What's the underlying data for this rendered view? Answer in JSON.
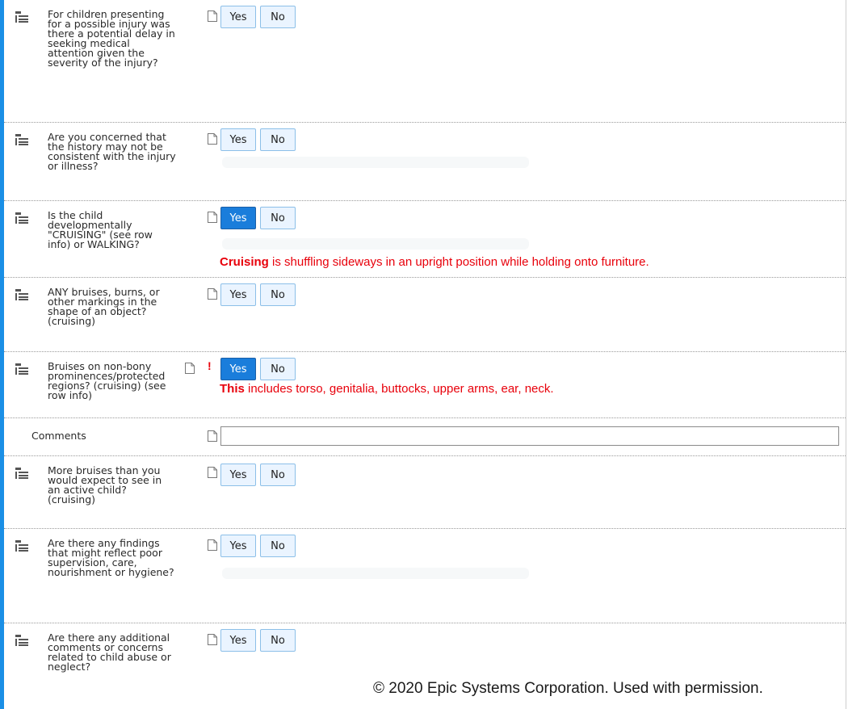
{
  "questions": [
    {
      "text": "For children presenting for a possible injury was there a potential delay in seeking medical attention given the severity of the injury?",
      "selected": null
    },
    {
      "text": "Are you concerned that the history may not be consistent with the injury or illness?",
      "selected": null
    },
    {
      "text": "Is the child developmentally \"CRUISING\" (see row info) or WALKING?",
      "selected": "Yes"
    },
    {
      "text": "ANY bruises, burns, or other markings in the shape of an object? (cruising)",
      "selected": null
    },
    {
      "text": "Bruises on non-bony prominences/protected regions? (cruising) (see row info)",
      "selected": "Yes"
    },
    {
      "text": "More bruises than you would expect to see in an active child? (cruising)",
      "selected": null
    },
    {
      "text": "Are there any findings that might reflect poor supervision, care, nourishment or hygiene?",
      "selected": null
    },
    {
      "text": "Are there any additional comments or concerns related to child abuse or neglect?",
      "selected": null
    }
  ],
  "buttons": {
    "yes": "Yes",
    "no": "No"
  },
  "annotations": {
    "cruising": {
      "bold": "Cruising",
      "rest": " is shuffling sideways in an upright position while holding onto furniture."
    },
    "bruises": {
      "bold": "This",
      "rest": " includes torso, genitalia, buttocks, upper arms, ear, neck."
    }
  },
  "required_marker": "!",
  "comments": {
    "label": "Comments",
    "value": ""
  },
  "copyright": "© 2020 Epic Systems Corporation. Used with permission.",
  "colors": {
    "accent": "#1a8fe6",
    "selected_button": "#1a7ddb",
    "button_bg": "#eaf4ff",
    "annotation_red": "#e8000b"
  }
}
